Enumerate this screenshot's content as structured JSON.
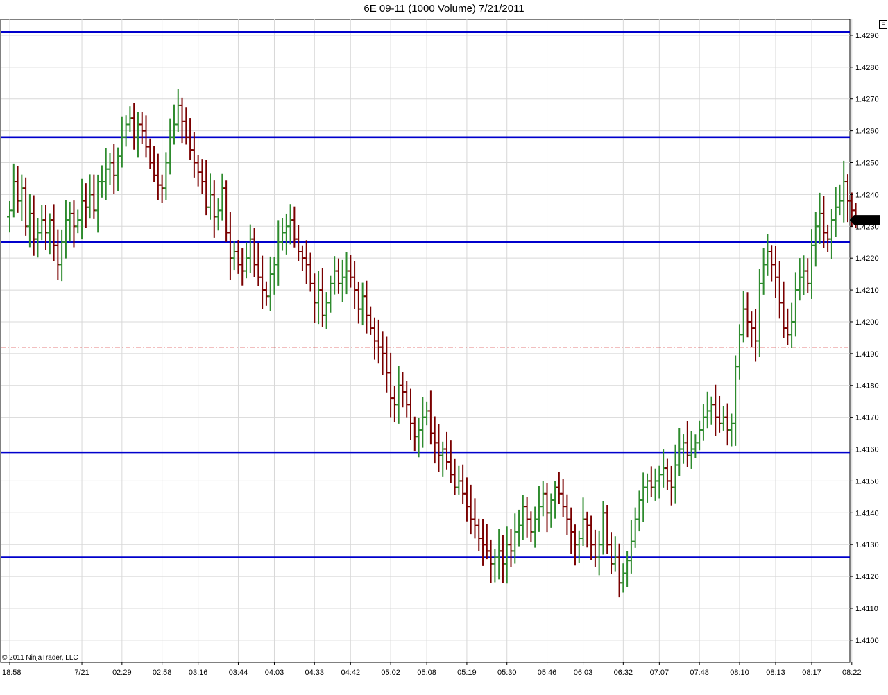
{
  "chart_data": {
    "type": "ohlc",
    "title": "6E 09-11 (1000 Volume)  7/21/2011",
    "copyright": "© 2011 NinjaTrader, LLC",
    "ylim": [
      1.4093,
      1.4295
    ],
    "y_ticks": [
      "1.4100",
      "1.4110",
      "1.4120",
      "1.4130",
      "1.4140",
      "1.4150",
      "1.4160",
      "1.4170",
      "1.4180",
      "1.4190",
      "1.4200",
      "1.4210",
      "1.4220",
      "1.4230",
      "1.4240",
      "1.4250",
      "1.4260",
      "1.4270",
      "1.4280",
      "1.4290"
    ],
    "x_ticks": [
      {
        "label": "18:58",
        "bar": 0
      },
      {
        "label": "7/21",
        "bar": 18
      },
      {
        "label": "02:29",
        "bar": 28
      },
      {
        "label": "02:58",
        "bar": 38
      },
      {
        "label": "03:16",
        "bar": 47
      },
      {
        "label": "03:44",
        "bar": 57
      },
      {
        "label": "04:03",
        "bar": 66
      },
      {
        "label": "04:33",
        "bar": 76
      },
      {
        "label": "04:42",
        "bar": 85
      },
      {
        "label": "05:02",
        "bar": 95
      },
      {
        "label": "05:08",
        "bar": 104
      },
      {
        "label": "05:19",
        "bar": 114
      },
      {
        "label": "05:30",
        "bar": 124
      },
      {
        "label": "05:46",
        "bar": 134
      },
      {
        "label": "06:03",
        "bar": 143
      },
      {
        "label": "06:32",
        "bar": 153
      },
      {
        "label": "07:07",
        "bar": 162
      },
      {
        "label": "07:48",
        "bar": 172
      },
      {
        "label": "08:10",
        "bar": 182
      },
      {
        "label": "08:13",
        "bar": 191
      },
      {
        "label": "08:17",
        "bar": 200
      },
      {
        "label": "08:22",
        "bar": 210
      }
    ],
    "current_price": "1.4232",
    "up_color": "#2e8b2e",
    "down_color": "#7a0000",
    "horizontal_lines": [
      {
        "price": 1.4291,
        "color": "#0000cc",
        "style": "solid"
      },
      {
        "price": 1.4258,
        "color": "#0000cc",
        "style": "solid"
      },
      {
        "price": 1.4225,
        "color": "#0000cc",
        "style": "solid"
      },
      {
        "price": 1.4159,
        "color": "#0000cc",
        "style": "solid"
      },
      {
        "price": 1.4126,
        "color": "#0000cc",
        "style": "solid"
      },
      {
        "price": 1.4192,
        "color": "#cc0000",
        "style": "dashdot"
      }
    ],
    "grid": true,
    "closes": [
      1.4235,
      1.4244,
      1.4238,
      1.4242,
      1.423,
      1.4234,
      1.4226,
      1.4228,
      1.4232,
      1.4228,
      1.4232,
      1.4224,
      1.4218,
      1.4225,
      1.4232,
      1.4234,
      1.423,
      1.4232,
      1.4238,
      1.4236,
      1.424,
      1.4235,
      1.4244,
      1.4244,
      1.4248,
      1.425,
      1.4246,
      1.4252,
      1.4258,
      1.4262,
      1.4264,
      1.4258,
      1.4262,
      1.426,
      1.4255,
      1.425,
      1.4246,
      1.4243,
      1.4242,
      1.425,
      1.4258,
      1.4262,
      1.4268,
      1.4263,
      1.4258,
      1.4254,
      1.425,
      1.4247,
      1.4244,
      1.4236,
      1.424,
      1.4233,
      1.4235,
      1.4242,
      1.4228,
      1.422,
      1.4222,
      1.4218,
      1.4216,
      1.422,
      1.4226,
      1.4218,
      1.4214,
      1.421,
      1.4208,
      1.4215,
      1.4218,
      1.4225,
      1.4228,
      1.423,
      1.4232,
      1.4226,
      1.4222,
      1.422,
      1.4218,
      1.4212,
      1.4206,
      1.421,
      1.4202,
      1.4206,
      1.4212,
      1.4216,
      1.4212,
      1.4214,
      1.4216,
      1.4214,
      1.421,
      1.4204,
      1.4208,
      1.4202,
      1.4198,
      1.4194,
      1.4192,
      1.419,
      1.4184,
      1.4176,
      1.4174,
      1.418,
      1.4178,
      1.4174,
      1.4168,
      1.4164,
      1.4166,
      1.417,
      1.4172,
      1.4165,
      1.4162,
      1.4158,
      1.416,
      1.4156,
      1.4152,
      1.4148,
      1.415,
      1.4146,
      1.4142,
      1.4138,
      1.4136,
      1.4132,
      1.413,
      1.4128,
      1.4124,
      1.4126,
      1.4128,
      1.4124,
      1.413,
      1.4128,
      1.4134,
      1.4136,
      1.4142,
      1.4138,
      1.4134,
      1.4138,
      1.4142,
      1.4146,
      1.414,
      1.4144,
      1.4148,
      1.4146,
      1.4142,
      1.4138,
      1.4134,
      1.413,
      1.4132,
      1.4138,
      1.4136,
      1.413,
      1.4126,
      1.413,
      1.414,
      1.413,
      1.4124,
      1.4126,
      1.4118,
      1.4121,
      1.4125,
      1.4131,
      1.4138,
      1.4144,
      1.4148,
      1.415,
      1.4148,
      1.415,
      1.4152,
      1.4154,
      1.415,
      1.4148,
      1.4155,
      1.416,
      1.4162,
      1.4158,
      1.416,
      1.4162,
      1.4166,
      1.417,
      1.4172,
      1.4174,
      1.417,
      1.4168,
      1.417,
      1.4166,
      1.4168,
      1.4186,
      1.4196,
      1.4204,
      1.42,
      1.4198,
      1.4194,
      1.4212,
      1.4218,
      1.4222,
      1.4218,
      1.4214,
      1.4206,
      1.4198,
      1.4196,
      1.42,
      1.421,
      1.4214,
      1.4216,
      1.4212,
      1.4224,
      1.423,
      1.4234,
      1.4228,
      1.4226,
      1.4232,
      1.4236,
      1.4238,
      1.4244,
      1.4238,
      1.4235,
      1.4232
    ]
  }
}
